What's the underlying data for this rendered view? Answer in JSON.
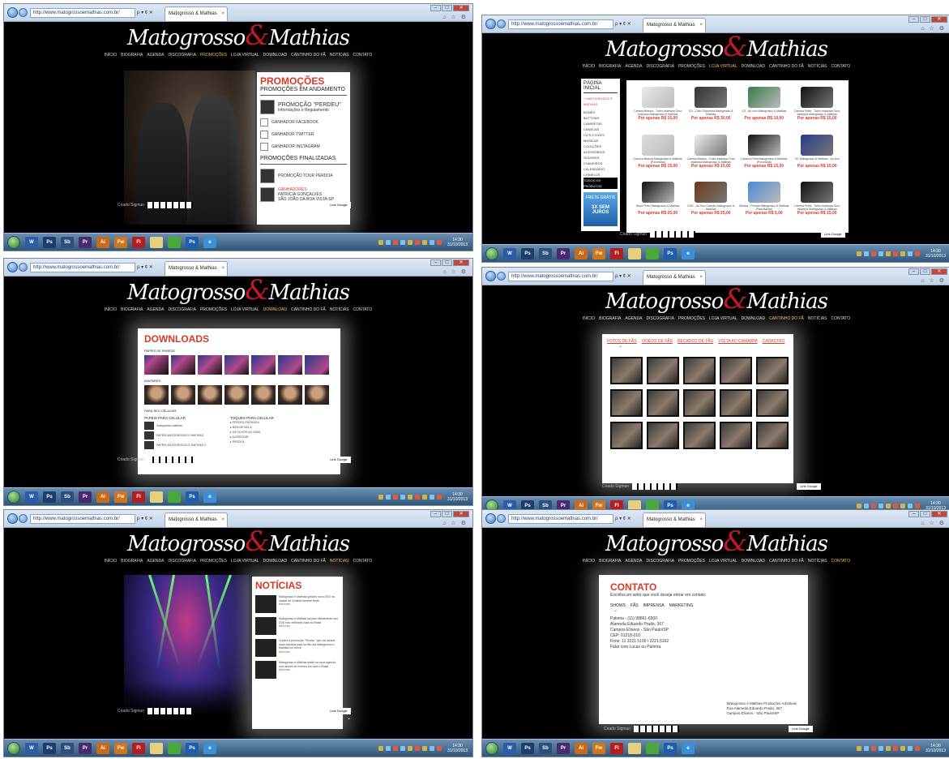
{
  "browser": {
    "url": "http://www.matogrossoemathias.com.br/",
    "tab_title": "Matogrosso & Mathias",
    "controls": "ρ ▾ ¢ ✕",
    "tab_close": "×",
    "win_min": "–",
    "win_max": "□",
    "win_close": "✕",
    "tools": "⌂ ☆ ⚙"
  },
  "site": {
    "logo_left": "Matogrosso",
    "logo_amp": "&",
    "logo_right": "Mathias",
    "nav": [
      "INÍCIO",
      "BIOGRAFIA",
      "AGENDA",
      "DISCOGRAFIA",
      "PROMOÇÕES",
      "LOJA VIRTUAL",
      "DOWNLOAD",
      "CANTINHO DO FÃ",
      "NOTÍCIAS",
      "CONTATO"
    ],
    "credits": "Criado Sigmun",
    "badge": "Link Google"
  },
  "promocoes": {
    "title": "PROMOÇÕES",
    "running": "PROMOÇÕES EM ANDAMENTO",
    "featured_title": "PROMOÇÃO \"PERDEU\"",
    "featured_sub": "Informações e Regulamento",
    "winners": [
      "GANHADOR FACEBOOK",
      "GANHADOR TWITTER",
      "GANHADOR INSTAGRAM"
    ],
    "finished": "PROMOÇÕES FINALIZADAS",
    "tour": "PROMOÇÃO TOUR PERDOA",
    "winner_label": "GANHADORES",
    "winner_name": "PATRICIA GONÇALVES",
    "winner_city": "SÃO JOÃO DA BOA VISTA-SP"
  },
  "loja": {
    "side_title": "PÁGINA INICIAL",
    "side_red": "+ MATOGROSSO E MATHIAS",
    "categories": [
      "BONÉS",
      "BUTTONS",
      "CAMISETAS",
      "CANECAS",
      "CD'S E DVD'S",
      "MÚSICAS",
      "COLEÇÕES",
      "ACESSÓRIOS",
      "SOUVEES",
      "CHAVEIROS",
      "CALENDÁRIO",
      "CHINELOS",
      "TODOS OS PRODUTOS"
    ],
    "ad_text": "FRETE GRÁTIS",
    "ad_sub": "3X SEM JUROS",
    "products": [
      {
        "name": "Camisa Branca - Turbo estampa Ouro estampa Matogrosso & Mathias",
        "price": "Por apenas R$ 15,00"
      },
      {
        "name": "CD - Com Orquestra Matogrosso & Mathias",
        "price": "Por apenas R$ 30,00"
      },
      {
        "name": "CD - Ao vivo Matogrosso & Mathias",
        "price": "Por apenas R$ 10,00"
      },
      {
        "name": "Camisa Preta - Turbo estampa Ouro estampa Matogrosso & Mathias",
        "price": "Por apenas R$ 15,00"
      },
      {
        "name": "Caneca Branca Matogrosso & Mathias (Porcelana)",
        "price": "Por apenas R$ 15,00"
      },
      {
        "name": "Camisa Branca - Turbo estampa Ouro estampa Matogrosso & Mathias",
        "price": "Por apenas R$ 15,00"
      },
      {
        "name": "Caneca Preta Matogrosso & Mathias (Porcelana)",
        "price": "Por apenas R$ 15,00"
      },
      {
        "name": "CD Matogrosso & Mathias - Ao vivo",
        "price": "Por apenas R$ 15,00"
      },
      {
        "name": "Boné Preto Matogrosso & Mathias",
        "price": "Por apenas R$ 25,00"
      },
      {
        "name": "DVD - Ao Vivo Canção Matogrosso & Mathias",
        "price": "Por apenas R$ 25,00"
      },
      {
        "name": "Música - Perdoa Matogrosso & Mathias (Para Baixar)",
        "price": "Por apenas R$ 5,00"
      },
      {
        "name": "Camisa Preta - Turbo estampa Ouro estampa Matogrosso & Mathias",
        "price": "Por apenas R$ 15,00"
      }
    ]
  },
  "downloads": {
    "title": "DOWNLOADS",
    "wallpapers": "PAPÉIS DE PAREDE",
    "avatars": "AVATARES",
    "mobile": "PARA SEU CELULAR",
    "mobile_wallpapers": "PAPÉIS PARA CELULAR",
    "ringtones": "TOQUES PARA CELULAR",
    "wallpaper_items": [
      "matogrosso-mathias",
      "PAPÉIS MATOGROSSO E MATHIAS",
      "PAPÉIS MATOGROSSO E MATHIAS 2"
    ],
    "ringtone_items": [
      "PERDEU ENGANOU",
      "NEM DE BOLA",
      "OS OLHOS DA CARA",
      "ACREDITAR",
      "PERDOA"
    ]
  },
  "cantinho": {
    "tabs": [
      "FOTOS DE FÃS",
      "VÍDEOS DE FÃS",
      "RECADOS DE FÃS",
      "VISITA AO CAMARIM",
      "CADASTRO"
    ]
  },
  "noticias": {
    "title": "NOTÍCIAS",
    "items": [
      "Matogrosso e Mathias gravam novo DVD na cidade de Goiânia durante festa",
      "Matogrosso e Mathias lançam oficialmente seu DVD nas melhores lojas do Brasil",
      "Confira a promoção \"Perdeu\" que vai sortear duas camisas para os fãs dos Matogrosso e Mathias em breve",
      "Matogrosso e Mathias estão na nova agenda com shows de inverno em todo o Brasil"
    ],
    "more": "leia mais"
  },
  "contato": {
    "title": "CONTATO",
    "intro": "Escolha um setor que você deseja entrar em contato:",
    "tabs": [
      "SHOWS",
      "FÃS",
      "IMPRENSA",
      "MARKETING"
    ],
    "lines": [
      "Paloma - (11) 98861-6500",
      "Alameda Eduardo Prado, 367",
      "Campos Elíseos - São Paulo/SP",
      "CEP: 01218-010",
      "Fone: 11 3221 5100 / 3221.5162",
      "Falar com Lucas ou Paloma"
    ],
    "footer": [
      "Matogrosso e Mathias Produções Artísticas",
      "Rua Alameda Eduardo Prado, 367",
      "Campos Elíseos - São Paulo/SP"
    ]
  },
  "taskbar": {
    "apps": [
      {
        "label": "W",
        "color": "#2b5caa"
      },
      {
        "label": "Ps",
        "color": "#1c3d6e"
      },
      {
        "label": "Sb",
        "color": "#2d4f7d"
      },
      {
        "label": "Pr",
        "color": "#4a2a6e"
      },
      {
        "label": "Ai",
        "color": "#c96a16"
      },
      {
        "label": "Fw",
        "color": "#d2751a"
      },
      {
        "label": "Fl",
        "color": "#b41e1e"
      },
      {
        "label": "",
        "color": "#e8d07a"
      },
      {
        "label": "",
        "color": "#4aa83a"
      },
      {
        "label": "Ps",
        "color": "#1c5fb0"
      },
      {
        "label": "e",
        "color": "#3a8fd6"
      }
    ],
    "time": "14:30",
    "date": "31/10/2013"
  }
}
